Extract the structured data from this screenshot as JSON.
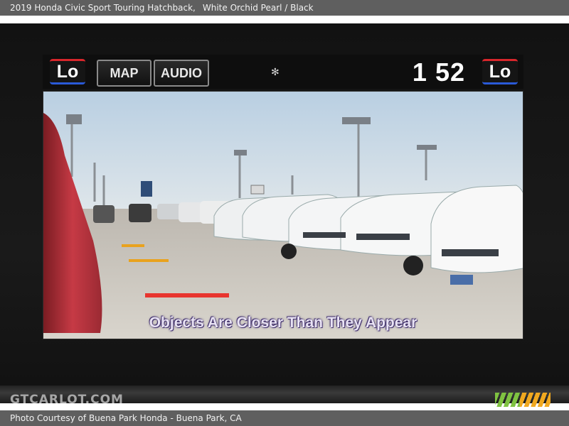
{
  "caption": {
    "vehicle": "2019 Honda Civic Sport Touring Hatchback,",
    "color": "White Orchid Pearl / Black",
    "credit": "Photo Courtesy of Buena Park Honda - Buena Park, CA"
  },
  "watermark": "GTCARLOT.COM",
  "screen": {
    "left_temp": "Lo",
    "right_temp": "Lo",
    "map_button": "MAP",
    "audio_button": "AUDIO",
    "clock": "1 52",
    "fan_icon": "fan-icon",
    "camera_warning": "Objects Are Closer Than They Appear"
  },
  "colors": {
    "guide_red": "#e8352f",
    "guide_yellow": "#e9a21e",
    "lo_top": "#d8262b",
    "lo_bottom": "#2a5ad8"
  }
}
